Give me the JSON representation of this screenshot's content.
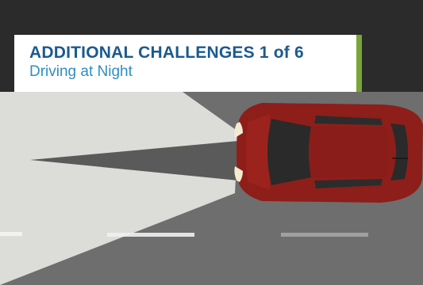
{
  "header": {
    "title": "ADDITIONAL CHALLENGES 1 of 6",
    "subtitle": "Driving at Night"
  },
  "colors": {
    "title": "#1b5a8e",
    "subtitle": "#2d8fc2",
    "accent": "#7aa53a",
    "road": "#6f6f6f",
    "headlight_beam": "#dcdcd8",
    "car_body": "#8e1e1a"
  },
  "icons": {
    "vehicle": "car-top-view-icon"
  }
}
